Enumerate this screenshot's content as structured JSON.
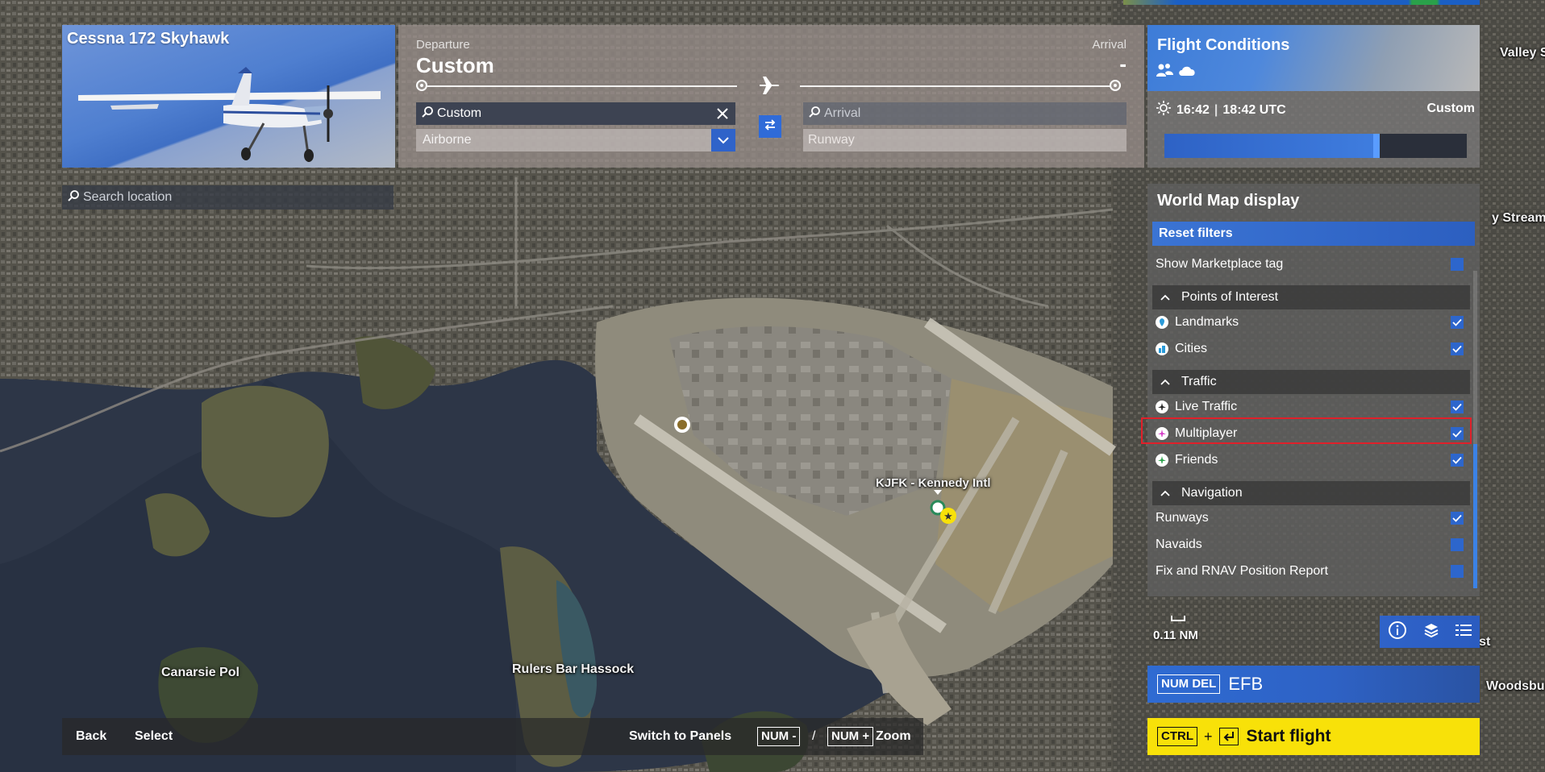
{
  "aircraft": {
    "name": "Cessna 172 Skyhawk"
  },
  "search": {
    "placeholder": "Search location"
  },
  "route": {
    "departure_label": "Departure",
    "departure_value": "Custom",
    "arrival_label": "Arrival",
    "arrival_value": "-",
    "departure_search": "Custom",
    "departure_state": "Airborne",
    "arrival_placeholder": "Arrival",
    "arrival_runway": "Runway"
  },
  "conditions": {
    "title": "Flight Conditions",
    "local_time": "16:42",
    "utc_time": "18:42 UTC",
    "mode": "Custom",
    "time_fraction": 0.7
  },
  "world_map": {
    "title": "World Map display",
    "reset": "Reset filters",
    "marketplace": "Show Marketplace tag",
    "sections": {
      "poi": "Points of Interest",
      "traffic": "Traffic",
      "navigation": "Navigation"
    },
    "items": {
      "landmarks": "Landmarks",
      "cities": "Cities",
      "live_traffic": "Live Traffic",
      "multiplayer": "Multiplayer",
      "friends": "Friends",
      "runways": "Runways",
      "navaids": "Navaids",
      "fix": "Fix and RNAV Position Report"
    }
  },
  "map": {
    "airport_label": "KJFK - Kennedy Intl",
    "labels": {
      "canarsie": "Canarsie Pol",
      "rulers": "Rulers Bar Hassock",
      "valley": "Valley Str",
      "stream": "y Stream",
      "cedarhurst": "Cedarhurst",
      "woodsburg": "Woodsburg"
    },
    "scale": "0.11 NM"
  },
  "efb": {
    "key": "NUM DEL",
    "label": "EFB"
  },
  "start": {
    "key": "CTRL",
    "plus": "+",
    "label": "Start flight"
  },
  "bottom": {
    "back": "Back",
    "select": "Select",
    "switch": "Switch to Panels",
    "num_minus": "NUM -",
    "slash": "/",
    "num_plus": "NUM +",
    "zoom": "Zoom"
  },
  "colors": {
    "accent_blue": "#2f63c9",
    "start_yellow": "#f8e109",
    "highlight_red": "#e0202a"
  }
}
